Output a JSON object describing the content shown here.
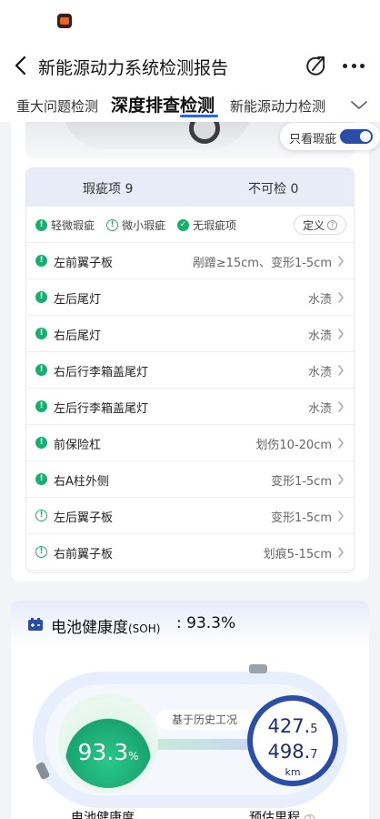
{
  "header": {
    "title": "新能源动力系统检测报告"
  },
  "tabs": [
    {
      "label": "重大问题检测"
    },
    {
      "label": "深度排查检测"
    },
    {
      "label": "新能源动力检测"
    }
  ],
  "filter": {
    "label": "只看瑕疵",
    "enabled": true
  },
  "summary": {
    "defects_label": "瑕疵项",
    "defects_count": "9",
    "uncheckable_label": "不可检",
    "uncheckable_count": "0"
  },
  "legend": {
    "minor": "轻微瑕疵",
    "tiny": "微小瑕疵",
    "none": "无瑕疵项",
    "define": "定义"
  },
  "rows": [
    {
      "name": "左前翼子板",
      "desc": "剐蹭≥15cm、变形1-5cm",
      "severity": "minor"
    },
    {
      "name": "左后尾灯",
      "desc": "水渍",
      "severity": "minor"
    },
    {
      "name": "右后尾灯",
      "desc": "水渍",
      "severity": "minor"
    },
    {
      "name": "右后行李箱盖尾灯",
      "desc": "水渍",
      "severity": "minor"
    },
    {
      "name": "左后行李箱盖尾灯",
      "desc": "水渍",
      "severity": "minor"
    },
    {
      "name": "前保险杠",
      "desc": "划伤10-20cm",
      "severity": "minor"
    },
    {
      "name": "右A柱外侧",
      "desc": "变形1-5cm",
      "severity": "minor"
    },
    {
      "name": "左后翼子板",
      "desc": "变形1-5cm",
      "severity": "tiny"
    },
    {
      "name": "右前翼子板",
      "desc": "划痕5-15cm",
      "severity": "tiny"
    }
  ],
  "battery": {
    "title": "电池健康度",
    "title_suffix": "(SOH)",
    "value_text": ": 93.3%",
    "gauge_int": "93.3",
    "gauge_unit": "%",
    "basis": "基于历史工况",
    "range_top_int": "427.",
    "range_top_dec": "5",
    "range_bot_int": "498.",
    "range_bot_dec": "7",
    "range_unit": "km",
    "label_health": "电池健康度",
    "label_range": "预估里程"
  },
  "colors": {
    "accent": "#2f62e8",
    "minor": "#14b06e",
    "dial": "#2a4ea8"
  }
}
